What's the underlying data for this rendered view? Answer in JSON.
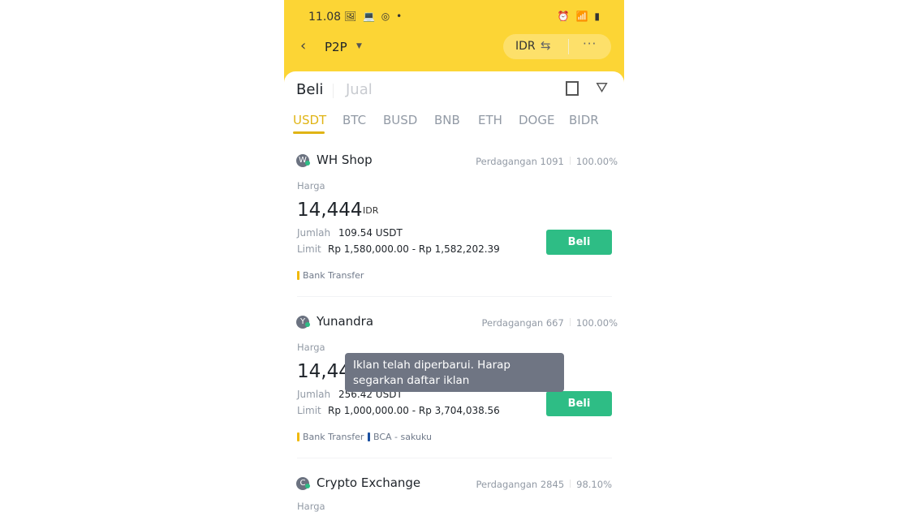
{
  "status_bar": {
    "time": "11.08",
    "left_icons": "🖼 💻 ◎ •",
    "right_icons": "⏰ 📶 ▮"
  },
  "header": {
    "back_icon": "chevron-left",
    "title": "P2P",
    "currency": "IDR",
    "swap_icon": "⇆",
    "more_icon": "···"
  },
  "trade_tabs": [
    {
      "label": "Beli",
      "active": true
    },
    {
      "label": "Jual",
      "active": false
    }
  ],
  "coins": [
    {
      "label": "USDT",
      "active": true
    },
    {
      "label": "BTC"
    },
    {
      "label": "BUSD"
    },
    {
      "label": "BNB"
    },
    {
      "label": "ETH"
    },
    {
      "label": "DOGE"
    },
    {
      "label": "BIDR"
    }
  ],
  "ads": [
    {
      "initial": "W",
      "name": "WH Shop",
      "trades_label": "Perdagangan 1091",
      "completion": "100.00%",
      "price_label": "Harga",
      "price": "14,444",
      "price_currency": "IDR",
      "amount_label": "Jumlah",
      "amount": "109.54 USDT",
      "limit_label": "Limit",
      "limit": "Rp 1,580,000.00 - Rp 1,582,202.39",
      "payments": [
        {
          "label": "Bank Transfer",
          "color": "#f0b90b"
        }
      ],
      "button": "Beli"
    },
    {
      "initial": "Y",
      "name": "Yunandra",
      "trades_label": "Perdagangan 667",
      "completion": "100.00%",
      "price_label": "Harga",
      "price": "14,44",
      "price_currency": "",
      "amount_label": "Jumlah",
      "amount": "256.42 USDT",
      "limit_label": "Limit",
      "limit": "Rp 1,000,000.00 - Rp 3,704,038.56",
      "payments": [
        {
          "label": "Bank Transfer",
          "color": "#f0b90b"
        },
        {
          "label": "BCA - sakuku",
          "color": "#1a4fa0"
        }
      ],
      "button": "Beli"
    },
    {
      "initial": "C",
      "name": "Crypto Exchange",
      "trades_label": "Perdagangan 2845",
      "completion": "98.10%",
      "price_label": "Harga"
    }
  ],
  "toast": "Iklan telah diperbarui. Harap segarkan daftar iklan",
  "colors": {
    "brand_yellow": "#fcd535",
    "buy_green": "#2ebd85",
    "active_coin": "#e0b415"
  }
}
